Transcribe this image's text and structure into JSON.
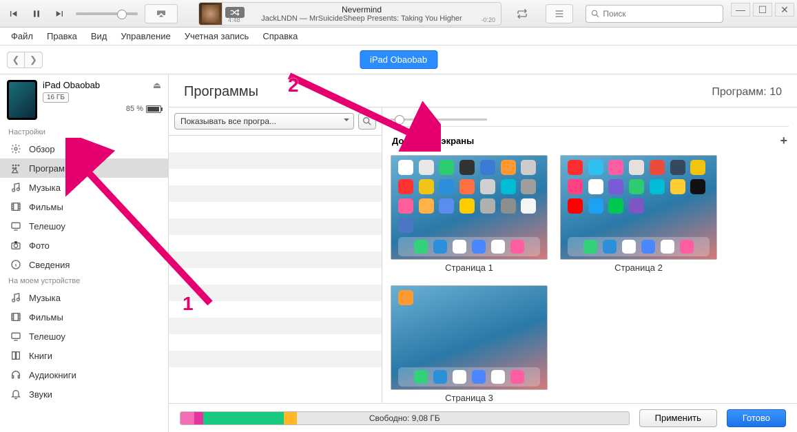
{
  "player": {
    "track_title": "Nevermind",
    "track_subtitle": "JackLNDN — MrSuicideSheep Presents: Taking You Higher",
    "elapsed": "4:48",
    "remaining": "-0:20",
    "search_placeholder": "Поиск"
  },
  "menubar": [
    "Файл",
    "Правка",
    "Вид",
    "Управление",
    "Учетная запись",
    "Справка"
  ],
  "device_pill": "iPad Obaobab",
  "sidebar": {
    "device_name": "iPad Obaobab",
    "capacity": "16 ГБ",
    "battery_pct": "85 %",
    "section_settings": "Настройки",
    "section_ondevice": "На моем устройстве",
    "settings_items": [
      {
        "icon": "gear",
        "label": "Обзор"
      },
      {
        "icon": "apps",
        "label": "Программы"
      },
      {
        "icon": "note",
        "label": "Музыка"
      },
      {
        "icon": "film",
        "label": "Фильмы"
      },
      {
        "icon": "tv",
        "label": "Телешоу"
      },
      {
        "icon": "camera",
        "label": "Фото"
      },
      {
        "icon": "info",
        "label": "Сведения"
      }
    ],
    "device_items": [
      {
        "icon": "note",
        "label": "Музыка"
      },
      {
        "icon": "film",
        "label": "Фильмы"
      },
      {
        "icon": "tv",
        "label": "Телешоу"
      },
      {
        "icon": "book",
        "label": "Книги"
      },
      {
        "icon": "headphones",
        "label": "Аудиокниги"
      },
      {
        "icon": "bell",
        "label": "Звуки"
      }
    ]
  },
  "content": {
    "title": "Программы",
    "count_label": "Программ: 10",
    "dropdown": "Показывать все програ...",
    "screens_header": "Домашние экраны",
    "pages": [
      "Страница 1",
      "Страница 2",
      "Страница 3"
    ]
  },
  "footer": {
    "free_label": "Свободно: 9,08 ГБ",
    "apply": "Применить",
    "done": "Готово",
    "segments": [
      {
        "color": "#f26db4",
        "pct": 3
      },
      {
        "color": "#e335a0",
        "pct": 2
      },
      {
        "color": "#17c97e",
        "pct": 18
      },
      {
        "color": "#ffb627",
        "pct": 3
      },
      {
        "color": "#e6e6e6",
        "pct": 74
      }
    ]
  },
  "annotations": {
    "one": "1",
    "two": "2"
  },
  "screen_icon_colors": [
    "#ffffff",
    "#e8e8e8",
    "#2ecc71",
    "#333333",
    "#3a7bd5",
    "#ff9933",
    "#cccccc",
    "#ff3333",
    "#f0c419",
    "#2b90d9",
    "#ff7043",
    "#d0d0d0",
    "#00bcd4",
    "#9e9e9e",
    "#ff5e9c",
    "#ffb347",
    "#5a8dee",
    "#ffcc00",
    "#b0b0b0",
    "#8e8e8e",
    "#f5f5f5",
    "#4a76c4"
  ],
  "screen2_icon_colors": [
    "#ff2d2d",
    "#30c0f0",
    "#ff5da2",
    "#e6e0dc",
    "#e74c3c",
    "#34495e",
    "#f1c40f",
    "#ff4081",
    "#ffffff",
    "#7a5bd7",
    "#2ecc71",
    "#00bcd4",
    "#ffcc33",
    "#111111",
    "#ff0000",
    "#1da1f2",
    "#00c853",
    "#7e57c2"
  ],
  "dock_icons": [
    "#33d17a",
    "#2b90d9",
    "#ffffff",
    "#4a86ff",
    "#ffffff",
    "#ff5da2"
  ]
}
